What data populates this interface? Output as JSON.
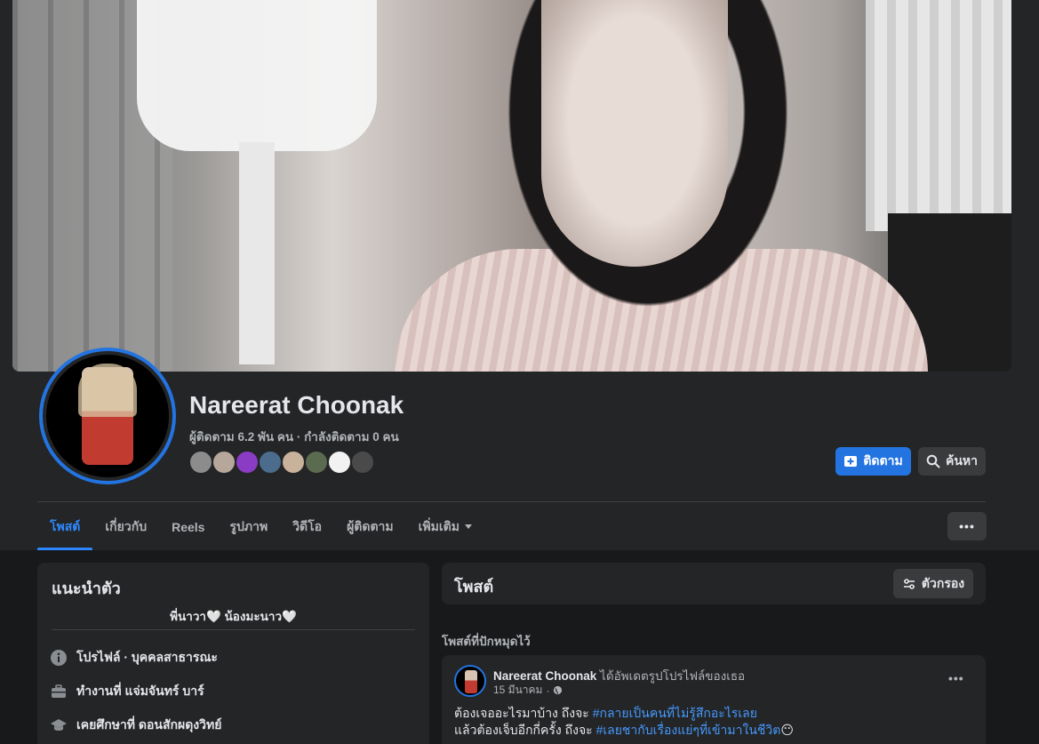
{
  "profile": {
    "name": "Nareerat Choonak",
    "follow_line": "ผู้ติดตาม 6.2 พัน คน · กำลังติดตาม 0 คน",
    "follower_avatar_colors": [
      "#8c8c8c",
      "#b6a79a",
      "#8a3cc4",
      "#4b6c8c",
      "#c9b29b",
      "#5a6b4f",
      "#f2f2f2",
      "#4a4a4a"
    ]
  },
  "actions": {
    "follow_label": "ติดตาม",
    "search_label": "ค้นหา",
    "more_label": "•••"
  },
  "tabs": [
    {
      "label": "โพสต์"
    },
    {
      "label": "เกี่ยวกับ"
    },
    {
      "label": "Reels"
    },
    {
      "label": "รูปภาพ"
    },
    {
      "label": "วิดีโอ"
    },
    {
      "label": "ผู้ติดตาม"
    },
    {
      "label": "เพิ่มเติม"
    }
  ],
  "intro": {
    "title": "แนะนำตัว",
    "bio": "พี่นาวา🤍 น้องมะนาว🤍",
    "rows": [
      {
        "icon": "info-icon",
        "bold": "โปรไฟล์",
        "rest": " · บุคคลสาธารณะ"
      },
      {
        "icon": "briefcase-icon",
        "bold": "",
        "rest": "ทำงานที่ แจ่มจันทร์ บาร์"
      },
      {
        "icon": "graduation-cap-icon",
        "bold": "",
        "rest": "เคยศึกษาที่ ดอนสักผดุงวิทย์"
      }
    ]
  },
  "posts": {
    "title": "โพสต์",
    "filter_label": "ตัวกรอง",
    "pinned_label": "โพสต์ที่ปักหมุดไว้"
  },
  "post": {
    "author": "Nareerat Choonak",
    "action": " ได้อัพเดตรูปโปรไฟล์ของเธอ",
    "date": "15 มีนาคม",
    "dots": "•••",
    "line1_text": "ต้องเจออะไรมาบ้าง ถึงจะ ",
    "line1_tag": "#กลายเป็นคนที่ไม่รู้สึกอะไรเลย",
    "line2_text": "แล้วต้องเจ็บอีกกี่ครั้ง ถึงจะ ",
    "line2_tag": "#เลยชากับเรื่องแย่ๆที่เข้ามาในชีวิต",
    "line2_emoji": "😶"
  }
}
